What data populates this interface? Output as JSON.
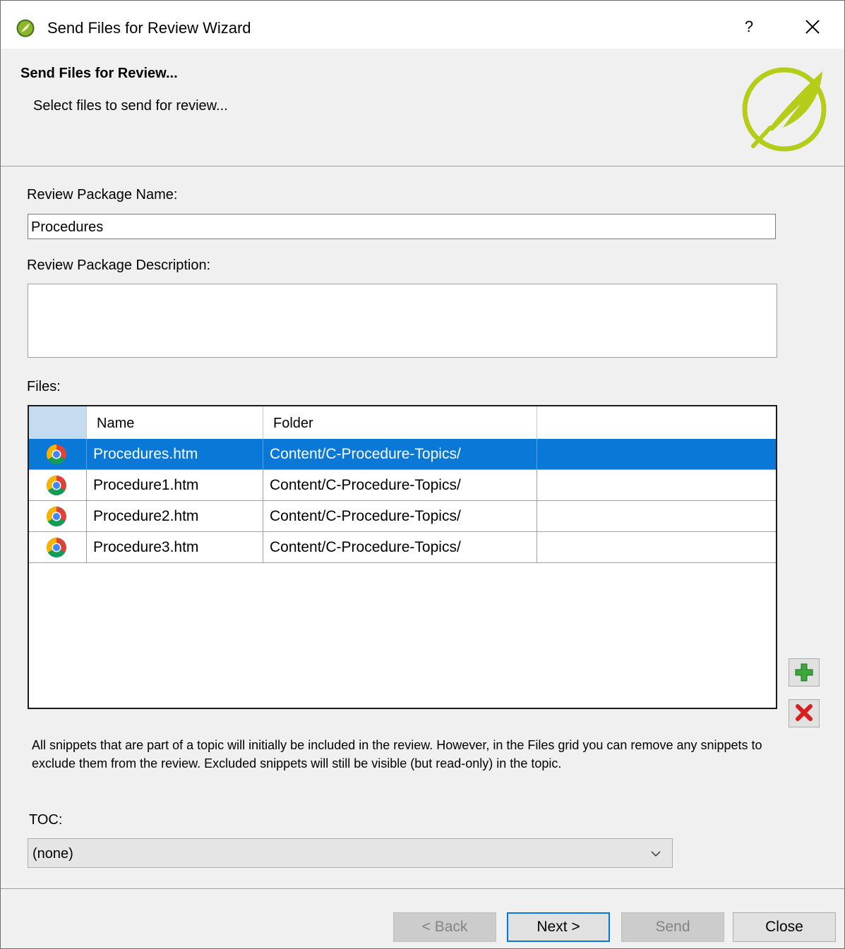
{
  "window": {
    "title": "Send Files for Review Wizard",
    "help_label": "?"
  },
  "header": {
    "title": "Send Files for Review...",
    "subtitle": "Select files to send for review..."
  },
  "form": {
    "package_name_label": "Review Package Name:",
    "package_name_value": "Procedures",
    "package_description_label": "Review Package Description:",
    "package_description_value": "",
    "files_label": "Files:"
  },
  "files_grid": {
    "columns": [
      "",
      "Name",
      "Folder",
      ""
    ],
    "rows": [
      {
        "icon": "chrome-icon",
        "name": "Procedures.htm",
        "folder": "Content/C-Procedure-Topics/",
        "extra": "",
        "selected": true
      },
      {
        "icon": "chrome-icon",
        "name": "Procedure1.htm",
        "folder": "Content/C-Procedure-Topics/",
        "extra": "",
        "selected": false
      },
      {
        "icon": "chrome-icon",
        "name": "Procedure2.htm",
        "folder": "Content/C-Procedure-Topics/",
        "extra": "",
        "selected": false
      },
      {
        "icon": "chrome-icon",
        "name": "Procedure3.htm",
        "folder": "Content/C-Procedure-Topics/",
        "extra": "",
        "selected": false
      }
    ]
  },
  "side_buttons": {
    "add_icon": "plus-icon",
    "remove_icon": "delete-x-icon"
  },
  "note": "All snippets that are part of a topic will initially be included in the review. However, in the Files grid you can remove any snippets to exclude them from the review. Excluded snippets will still be visible (but read-only) in the topic.",
  "toc": {
    "label": "TOC:",
    "selected": "(none)"
  },
  "footer": {
    "back_label": "< Back",
    "next_label": "Next >",
    "send_label": "Send",
    "close_label": "Close"
  },
  "colors": {
    "selection": "#0a78d7",
    "brand_green": "#b5cc18",
    "add_green": "#3aa83a",
    "remove_red": "#d81e1e"
  }
}
